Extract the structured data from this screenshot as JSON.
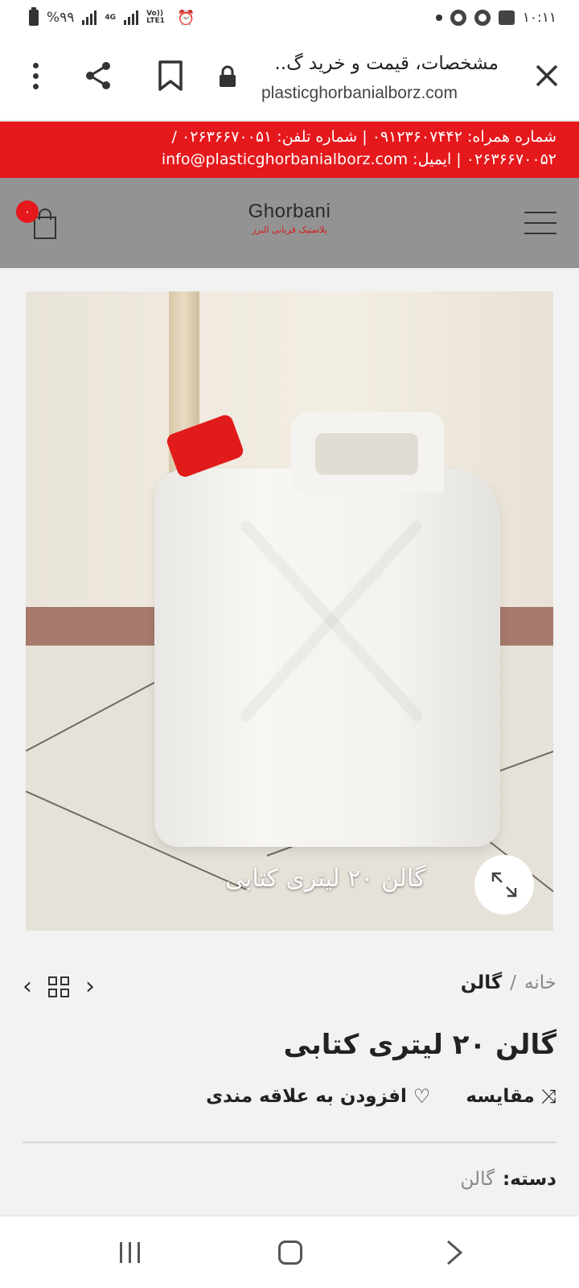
{
  "status_bar": {
    "battery": "%۹۹",
    "network_4g": "4G",
    "volte": "Vo)) LTE1",
    "time": "۱۰:۱۱"
  },
  "browser": {
    "page_title": "مشخصات، قیمت و خرید گ..",
    "domain": "plasticghorbanialborz.com",
    "icons": [
      "menu-dots-icon",
      "share-icon",
      "bookmark-icon",
      "lock-icon",
      "close-icon"
    ]
  },
  "info_bar": {
    "line1": "شماره همراه: ۰۹۱۲۳۶۰۷۴۴۲  |  شماره تلفن: ۰۲۶۳۶۶۷۰۰۵۱  /",
    "line2": "۰۲۶۳۶۶۷۰۰۵۲  |  ایمیل: info@plasticghorbanialborz.com"
  },
  "header": {
    "cart_count": "۰",
    "logo_text": "Ghorbani",
    "logo_subtext": "پلاستیک قربانی البرز"
  },
  "product": {
    "image_caption": "گالن ۲۰ لیتری کتابی",
    "title": "گالن ۲۰ لیتری کتابی"
  },
  "breadcrumb": {
    "home": "خانه",
    "separator": "/",
    "current": "گالن"
  },
  "actions": {
    "compare": "مقایسه",
    "wishlist": "افزودن به علاقه مندی"
  },
  "category": {
    "label": "دسته:",
    "value": "گالن"
  },
  "colors": {
    "info_bar": "#e5181c",
    "header_bg": "#939393",
    "page_bg": "#f2f2f2"
  }
}
